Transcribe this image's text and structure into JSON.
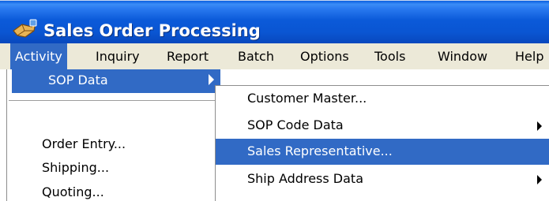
{
  "window": {
    "title": "Sales Order Processing",
    "title_icon": "module-icon"
  },
  "menubar": {
    "items": [
      {
        "label": "Activity",
        "active": true
      },
      {
        "label": "Inquiry"
      },
      {
        "label": "Report"
      },
      {
        "label": "Batch"
      },
      {
        "label": "Options"
      },
      {
        "label": "Tools"
      },
      {
        "label": "Window"
      },
      {
        "label": "Help"
      }
    ]
  },
  "activity_menu": {
    "highlighted": {
      "label": "SOP Data",
      "has_submenu": true
    },
    "items": [
      {
        "label": "Order Entry..."
      },
      {
        "label": "Shipping..."
      },
      {
        "label": "Quoting..."
      }
    ]
  },
  "sop_data_submenu": {
    "items": [
      {
        "label": "Customer Master...",
        "has_submenu": false
      },
      {
        "label": "SOP Code Data",
        "has_submenu": true
      },
      {
        "label": "Sales Representative...",
        "has_submenu": false,
        "active": true
      },
      {
        "label": "Ship Address Data",
        "has_submenu": true
      }
    ]
  },
  "colors": {
    "titlebar": "#0a55d2",
    "menubar": "#ece9d8",
    "highlight": "#316ac5",
    "highlight_text": "#ffffff"
  }
}
